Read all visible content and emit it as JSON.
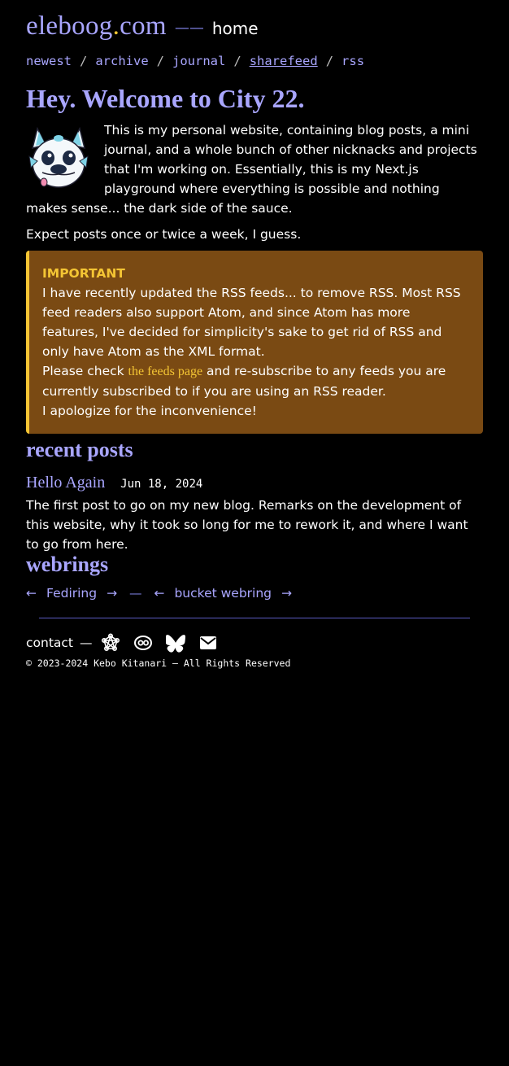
{
  "header": {
    "site_name_main": "eleboog",
    "site_name_dot": ".",
    "site_name_tld": "com",
    "separator": "——",
    "home_label": "home"
  },
  "nav": {
    "items": [
      {
        "label": "newest"
      },
      {
        "label": "archive"
      },
      {
        "label": "journal"
      },
      {
        "label": "sharefeed"
      },
      {
        "label": "rss"
      }
    ],
    "separator": "/"
  },
  "hero": {
    "title": "Hey. Welcome to City 22."
  },
  "intro": {
    "paragraph1": "This is my personal website, containing blog posts, a mini journal, and a whole bunch of other nicknacks and projects that I'm working on. Essentially, this is my Next.js playground where everything is possible and nothing makes sense... the dark side of the sauce.",
    "paragraph2": "Expect posts once or twice a week, I guess."
  },
  "callout": {
    "title": "IMPORTANT",
    "body1": "I have recently updated the RSS feeds... to remove RSS. Most RSS feed readers also support Atom, and since Atom has more features, I've decided for simplicity's sake to get rid of RSS and only have Atom as the XML format.",
    "body2_pre": "Please check ",
    "body2_link": "the feeds page",
    "body2_post": " and re-subscribe to any feeds you are currently subscribed to if you are using an RSS reader.",
    "body3": "I apologize for the inconvenience!"
  },
  "recent": {
    "heading": "recent posts",
    "posts": [
      {
        "title": "Hello Again",
        "date": "Jun 18, 2024",
        "description": "The first post to go on my new blog. Remarks on the development of this website, why it took so long for me to rework it, and where I want to go from here."
      }
    ]
  },
  "webrings": {
    "heading": "webrings",
    "rings": [
      {
        "prev": "←",
        "name": "Fediring",
        "next": "→"
      },
      {
        "prev": "←",
        "name": "bucket webring",
        "next": "→"
      }
    ],
    "separator": "—"
  },
  "footer": {
    "contact_label": "contact",
    "contact_dash": "—",
    "icons": [
      "fediverse-icon",
      "cohost-icon",
      "bluesky-icon",
      "email-icon"
    ],
    "copyright": "© 2023-2024 Kebo Kitanari — All Rights Reserved"
  },
  "colors": {
    "background": "#000000",
    "accent": "#a9a6ff",
    "callout_bg": "#7a4a13",
    "callout_accent": "#f4c534"
  }
}
